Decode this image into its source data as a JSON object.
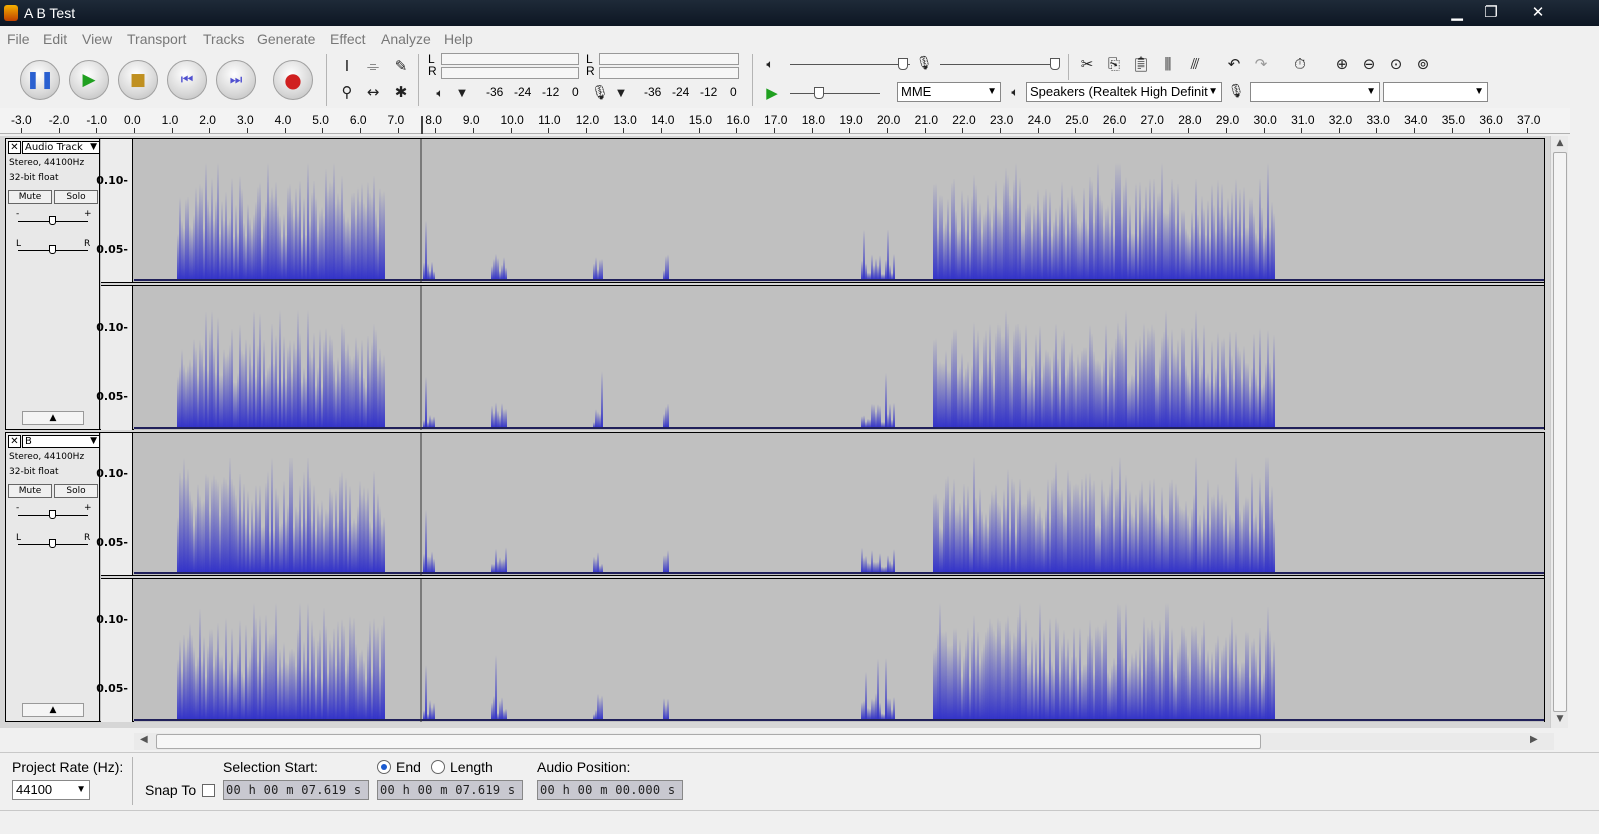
{
  "window": {
    "title": "A B Test",
    "minimize": "▁",
    "restore": "❐",
    "close": "✕"
  },
  "menu": [
    "File",
    "Edit",
    "View",
    "Transport",
    "Tracks",
    "Generate",
    "Effect",
    "Analyze",
    "Help"
  ],
  "transport": {
    "pause_icon": "pause-icon",
    "play_icon": "play-icon",
    "stop_icon": "stop-icon",
    "skip_start_icon": "skip-to-start-icon",
    "skip_end_icon": "skip-to-end-icon",
    "record_icon": "record-icon"
  },
  "meters": {
    "record_lr": [
      "L",
      "R"
    ],
    "play_lr": [
      "L",
      "R"
    ],
    "play_scale": [
      "-36",
      "-24",
      "-12",
      "0"
    ],
    "rec_scale": [
      "-36",
      "-24",
      "-12",
      "0"
    ]
  },
  "device": {
    "host": "MME",
    "output": "Speakers (Realtek High Definit",
    "input": "",
    "channels": ""
  },
  "ruler": {
    "ticks": [
      "-3.0",
      "-2.0",
      "-1.0",
      "0.0",
      "1.0",
      "2.0",
      "3.0",
      "4.0",
      "5.0",
      "6.0",
      "7.0",
      "8.0",
      "9.0",
      "10.0",
      "11.0",
      "12.0",
      "13.0",
      "14.0",
      "15.0",
      "16.0",
      "17.0",
      "18.0",
      "19.0",
      "20.0",
      "21.0",
      "22.0",
      "23.0",
      "24.0",
      "25.0",
      "26.0",
      "27.0",
      "28.0",
      "29.0",
      "30.0",
      "31.0",
      "32.0",
      "33.0",
      "34.0",
      "35.0",
      "36.0",
      "37.0"
    ]
  },
  "tracks": [
    {
      "name": "Audio Track",
      "info1": "Stereo, 44100Hz",
      "info2": "32-bit float",
      "mute": "Mute",
      "solo": "Solo",
      "gain_minus": "-",
      "gain_plus": "+",
      "pan_left": "L",
      "pan_right": "R",
      "scale": [
        "0.10-",
        "0.05-"
      ]
    },
    {
      "name": "B",
      "info1": "Stereo, 44100Hz",
      "info2": "32-bit float",
      "mute": "Mute",
      "solo": "Solo",
      "gain_minus": "-",
      "gain_plus": "+",
      "pan_left": "L",
      "pan_right": "R",
      "scale": [
        "0.10-",
        "0.05-"
      ]
    }
  ],
  "selection_bar": {
    "project_rate_label": "Project Rate (Hz):",
    "project_rate": "44100",
    "snap_to_label": "Snap To",
    "selection_start_label": "Selection Start:",
    "end_label": "End",
    "length_label": "Length",
    "audio_position_label": "Audio Position:",
    "selection_start": "00 h 00 m 07.619 s",
    "selection_end": "00 h 00 m 07.619 s",
    "audio_position": "00 h 00 m 00.000 s",
    "end_selected": true
  },
  "colors": {
    "waveform": "#3232c8",
    "waveform_rms": "#6464dc",
    "track_bg": "#c0c0c0"
  }
}
